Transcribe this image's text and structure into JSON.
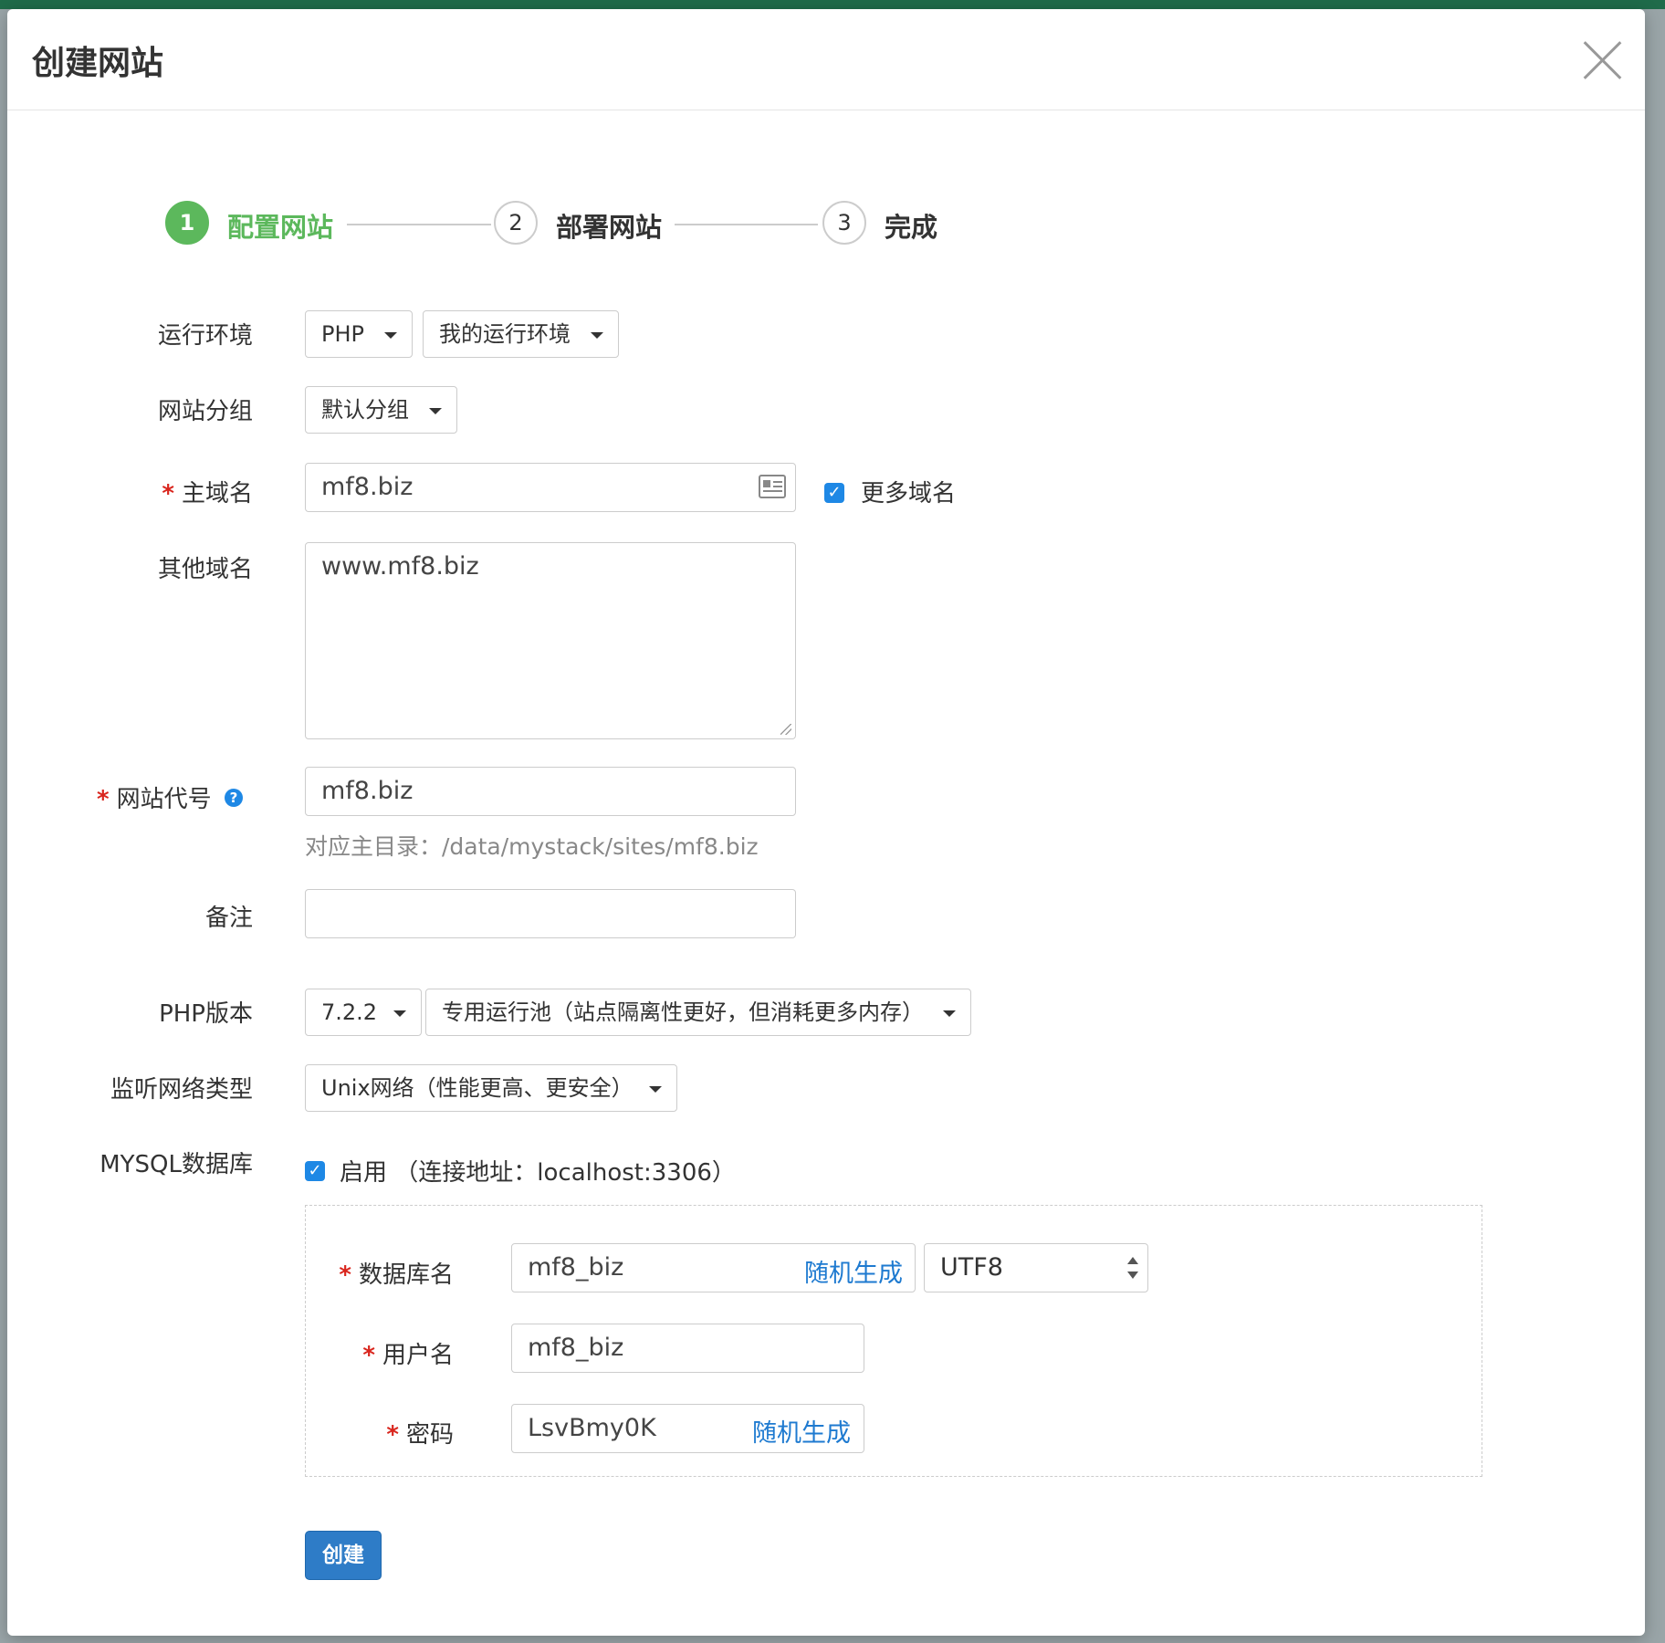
{
  "modal": {
    "title": "创建网站"
  },
  "steps": [
    {
      "number": "1",
      "label": "配置网站",
      "active": true
    },
    {
      "number": "2",
      "label": "部署网站",
      "active": false
    },
    {
      "number": "3",
      "label": "完成",
      "active": false
    }
  ],
  "form": {
    "runtime": {
      "label": "运行环境",
      "type_value": "PHP",
      "env_value": "我的运行环境"
    },
    "site_group": {
      "label": "网站分组",
      "value": "默认分组"
    },
    "primary_domain": {
      "label": "主域名",
      "value": "mf8.biz",
      "more_domains_label": "更多域名",
      "more_domains_checked": true
    },
    "other_domains": {
      "label": "其他域名",
      "value": "www.mf8.biz"
    },
    "site_code": {
      "label": "网站代号",
      "value": "mf8.biz",
      "hint": "对应主目录：/data/mystack/sites/mf8.biz"
    },
    "remark": {
      "label": "备注",
      "value": ""
    },
    "php_version": {
      "label": "PHP版本",
      "version_value": "7.2.2",
      "pool_value": "专用运行池（站点隔离性更好，但消耗更多内存）"
    },
    "listen_network": {
      "label": "监听网络类型",
      "value": "Unix网络（性能更高、更安全）"
    },
    "mysql": {
      "label": "MYSQL数据库",
      "enabled_checked": true,
      "enabled_label": "启用 （连接地址：localhost:3306）",
      "db_name": {
        "label": "数据库名",
        "value": "mf8_biz",
        "random_label": "随机生成",
        "charset_value": "UTF8"
      },
      "username": {
        "label": "用户名",
        "value": "mf8_biz"
      },
      "password": {
        "label": "密码",
        "value": "LsvBmy0K",
        "random_label": "随机生成"
      }
    },
    "submit_label": "创建"
  },
  "colors": {
    "accent_green": "#5cb85c",
    "primary_blue": "#2e7cc7",
    "link_blue": "#1e7ad0",
    "required_red": "#d9251d"
  }
}
